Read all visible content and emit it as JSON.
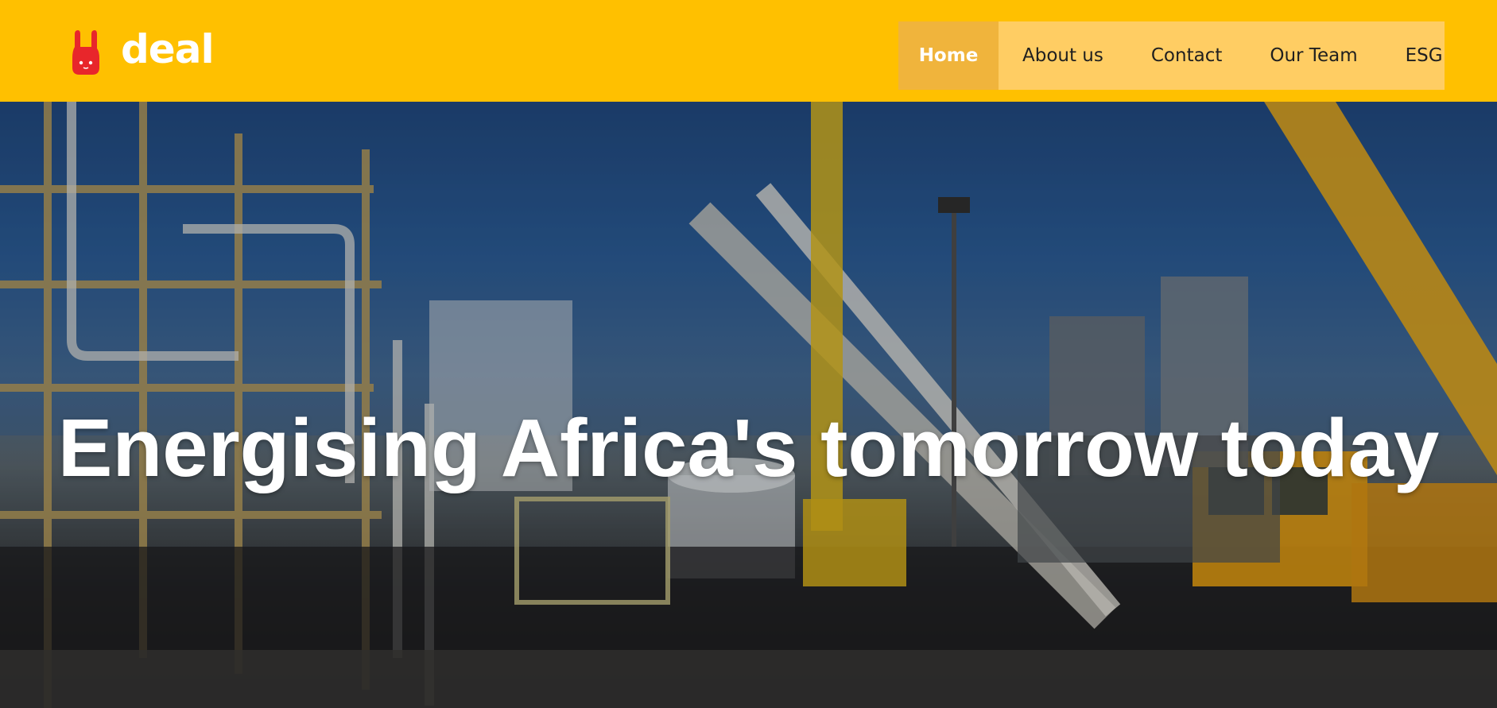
{
  "brand": {
    "name": "deal",
    "logo_icon": "rabbit-icon",
    "header_color": "#ffc000",
    "logo_color": "#e8262b"
  },
  "nav": {
    "items": [
      {
        "label": "Home",
        "active": true
      },
      {
        "label": "About us",
        "active": false
      },
      {
        "label": "Contact",
        "active": false
      },
      {
        "label": "Our Team",
        "active": false
      },
      {
        "label": "ESG",
        "active": false
      }
    ],
    "background": "#ffcd63",
    "active_background": "#f0b43c"
  },
  "hero": {
    "title": "Energising Africa's tomorrow today",
    "image_subject": "industrial-plant-with-cranes"
  }
}
